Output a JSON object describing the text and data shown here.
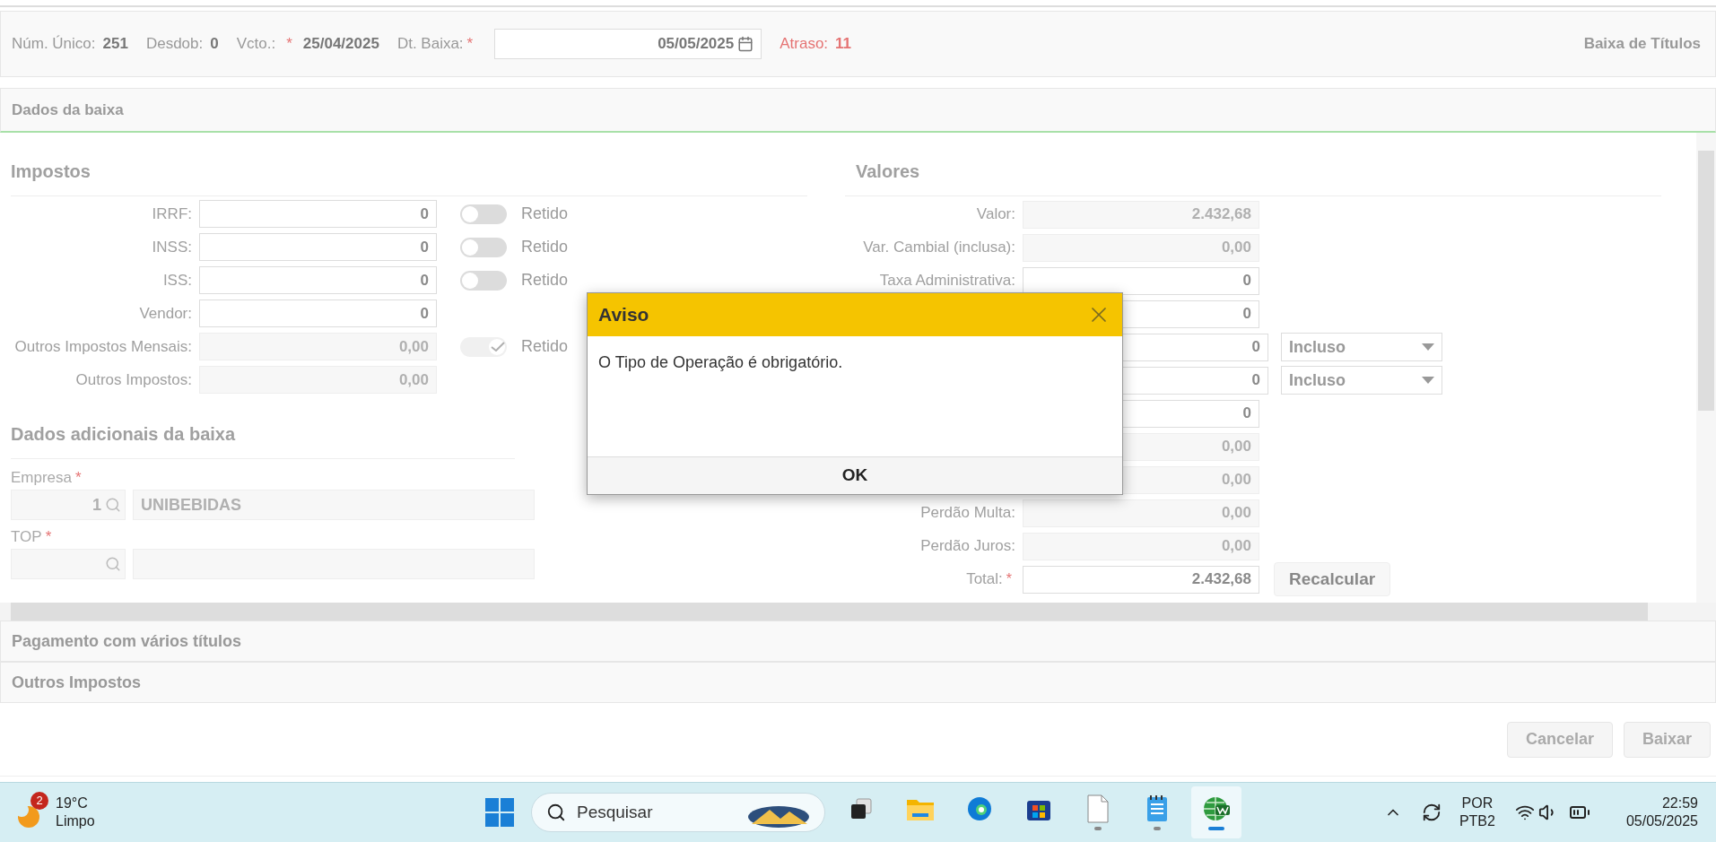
{
  "header": {
    "fields": [
      {
        "label": "Núm. Único:",
        "value": "251"
      },
      {
        "label": "Desdob:",
        "value": "0"
      },
      {
        "label": "Vcto.:",
        "value": "25/04/2025",
        "required_mark": "*"
      }
    ],
    "date_field": {
      "label": "Dt. Baixa:",
      "required_mark": "*",
      "value": "05/05/2025"
    },
    "delay": {
      "label": "Atraso:",
      "value": "11"
    },
    "title": "Baixa de Títulos"
  },
  "section_title": "Dados da baixa",
  "impostos": {
    "title": "Impostos",
    "rows": [
      {
        "label": "IRRF:",
        "value": "0",
        "disabled": false,
        "retido": {
          "on": false,
          "disabled": false,
          "label": "Retido"
        }
      },
      {
        "label": "INSS:",
        "value": "0",
        "disabled": false,
        "retido": {
          "on": false,
          "disabled": false,
          "label": "Retido"
        }
      },
      {
        "label": "ISS:",
        "value": "0",
        "disabled": false,
        "retido": {
          "on": false,
          "disabled": false,
          "label": "Retido"
        }
      },
      {
        "label": "Vendor:",
        "value": "0",
        "disabled": false
      },
      {
        "label": "Outros Impostos Mensais:",
        "value": "0,00",
        "disabled": true,
        "retido": {
          "on": true,
          "disabled": true,
          "label": "Retido"
        }
      },
      {
        "label": "Outros Impostos:",
        "value": "0,00",
        "disabled": true
      }
    ]
  },
  "adicionais": {
    "title": "Dados adicionais da baixa",
    "fields": [
      {
        "label": "Empresa",
        "required_mark": "*",
        "code": "1",
        "name": "UNIBEBIDAS"
      },
      {
        "label": "TOP",
        "required_mark": "*"
      }
    ]
  },
  "valores": {
    "title": "Valores",
    "rows": [
      {
        "label": "Valor:",
        "value": "2.432,68",
        "disabled": true
      },
      {
        "label": "Var. Cambial (inclusa):",
        "value": "0,00",
        "disabled": true
      },
      {
        "label": "Taxa Administrativa:",
        "value": "0",
        "disabled": false
      },
      {
        "value": "0",
        "disabled": false
      },
      {
        "value": "0",
        "disabled": false,
        "select": "Incluso"
      },
      {
        "value": "0",
        "disabled": false,
        "select": "Incluso"
      },
      {
        "value": "0",
        "disabled": false
      },
      {
        "value": "0,00",
        "disabled": true
      },
      {
        "value": "0,00",
        "disabled": true
      },
      {
        "label": "Perdão Multa:",
        "value": "0,00",
        "disabled": true
      },
      {
        "label": "Perdão Juros:",
        "value": "0,00",
        "disabled": true
      },
      {
        "label": "Total:",
        "value": "2.432,68",
        "disabled": false,
        "required_mark": "*",
        "button": "Recalcular"
      }
    ]
  },
  "collapsed_sections": [
    "Pagamento com vários títulos",
    "Outros Impostos"
  ],
  "buttons": [
    {
      "label": "Cancelar",
      "disabled": true
    },
    {
      "label": "Baixar",
      "disabled": true
    }
  ],
  "dialog": {
    "title": "Aviso",
    "message": "O Tipo de Operação é obrigatório.",
    "button": "OK"
  },
  "taskbar": {
    "weather": {
      "badge": "2",
      "temperature": "19°C",
      "condition": "Limpo"
    },
    "search": {
      "placeholder": "Pesquisar"
    },
    "apps": [
      {
        "kind": "taskview",
        "running": false,
        "active": false
      },
      {
        "kind": "folder",
        "running": false,
        "active": false
      },
      {
        "kind": "browser",
        "running": false,
        "active": false
      },
      {
        "kind": "store",
        "running": false,
        "active": false
      },
      {
        "kind": "document",
        "running": true,
        "active": false
      },
      {
        "kind": "notepad",
        "running": true,
        "active": false
      },
      {
        "kind": "globe",
        "running": true,
        "active": true
      }
    ],
    "language": "POR",
    "layout": "PTB2",
    "time": "22:59",
    "date": "05/05/2025"
  }
}
